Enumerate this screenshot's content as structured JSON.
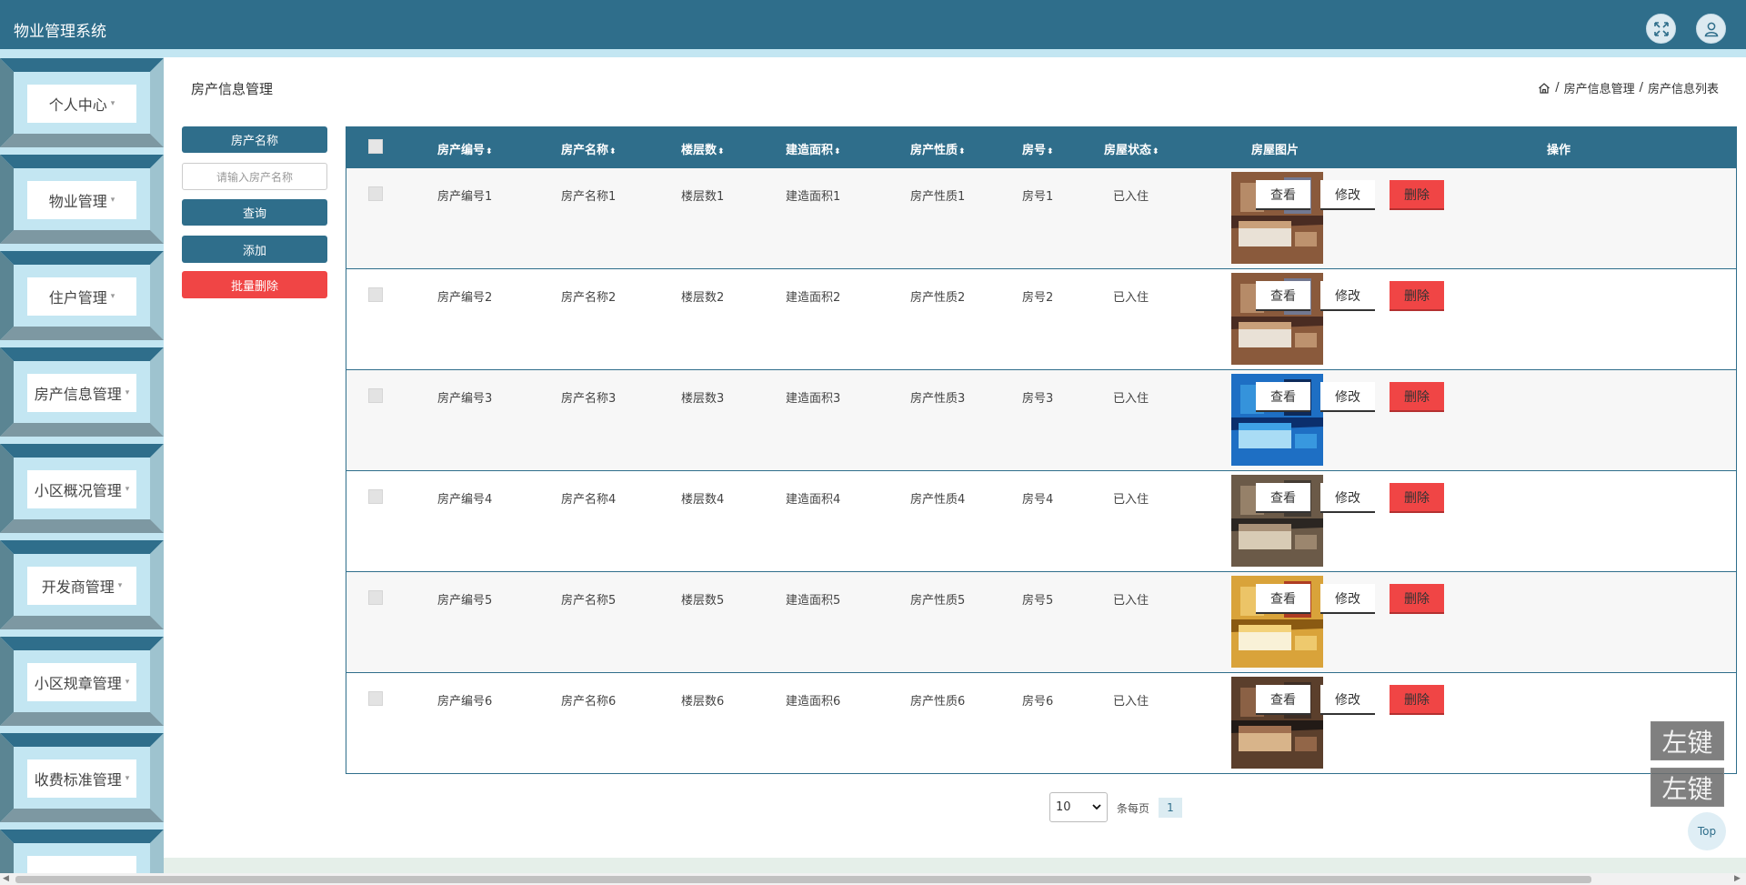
{
  "app": {
    "title": "物业管理系统",
    "fullscreen_icon": "expand-arrows-icon",
    "user_icon": "user-icon",
    "accent_color": "#2f6e8b",
    "danger_color": "#f04545"
  },
  "sidebar": {
    "items": [
      {
        "label": "个人中心"
      },
      {
        "label": "物业管理"
      },
      {
        "label": "住户管理"
      },
      {
        "label": "房产信息管理"
      },
      {
        "label": "小区概况管理"
      },
      {
        "label": "开发商管理"
      },
      {
        "label": "小区规章管理"
      },
      {
        "label": "收费标准管理"
      },
      {
        "label": ""
      }
    ]
  },
  "page": {
    "title": "房产信息管理",
    "breadcrumb": [
      "房产信息管理",
      "房产信息列表"
    ],
    "breadcrumb_sep": "/"
  },
  "search": {
    "field_label": "房产名称",
    "placeholder": "请输入房产名称",
    "query_label": "查询",
    "add_label": "添加",
    "batch_delete_label": "批量删除"
  },
  "table": {
    "columns": [
      "房产编号",
      "房产名称",
      "楼层数",
      "建造面积",
      "房产性质",
      "房号",
      "房屋状态",
      "房屋图片",
      "操作"
    ],
    "sort_glyph": "⬍",
    "actions": {
      "view": "查看",
      "edit": "修改",
      "delete": "删除"
    },
    "rows": [
      {
        "code": "房产编号1",
        "name": "房产名称1",
        "floors": "楼层数1",
        "area": "建造面积1",
        "nature": "房产性质1",
        "room": "房号1",
        "status": "已入住",
        "image": "hotel-room-photo"
      },
      {
        "code": "房产编号2",
        "name": "房产名称2",
        "floors": "楼层数2",
        "area": "建造面积2",
        "nature": "房产性质2",
        "room": "房号2",
        "status": "已入住",
        "image": "hotel-room-photo"
      },
      {
        "code": "房产编号3",
        "name": "房产名称3",
        "floors": "楼层数3",
        "area": "建造面积3",
        "nature": "房产性质3",
        "room": "房号3",
        "status": "已入住",
        "image": "aquarium-room-photo"
      },
      {
        "code": "房产编号4",
        "name": "房产名称4",
        "floors": "楼层数4",
        "area": "建造面积4",
        "nature": "房产性质4",
        "room": "房号4",
        "status": "已入住",
        "image": "twin-bed-room-photo"
      },
      {
        "code": "房产编号5",
        "name": "房产名称5",
        "floors": "楼层数5",
        "area": "建造面积5",
        "nature": "房产性质5",
        "room": "房号5",
        "status": "已入住",
        "image": "yellow-bedroom-photo"
      },
      {
        "code": "房产编号6",
        "name": "房产名称6",
        "floors": "楼层数6",
        "area": "建造面积6",
        "nature": "房产性质6",
        "room": "房号6",
        "status": "已入住",
        "image": "dark-bedroom-photo"
      }
    ]
  },
  "pagination": {
    "page_size": "10",
    "per_page_label": "条每页",
    "current_page": "1"
  },
  "overlays": {
    "tag1": "左键",
    "tag2": "左键",
    "top_label": "Top"
  }
}
